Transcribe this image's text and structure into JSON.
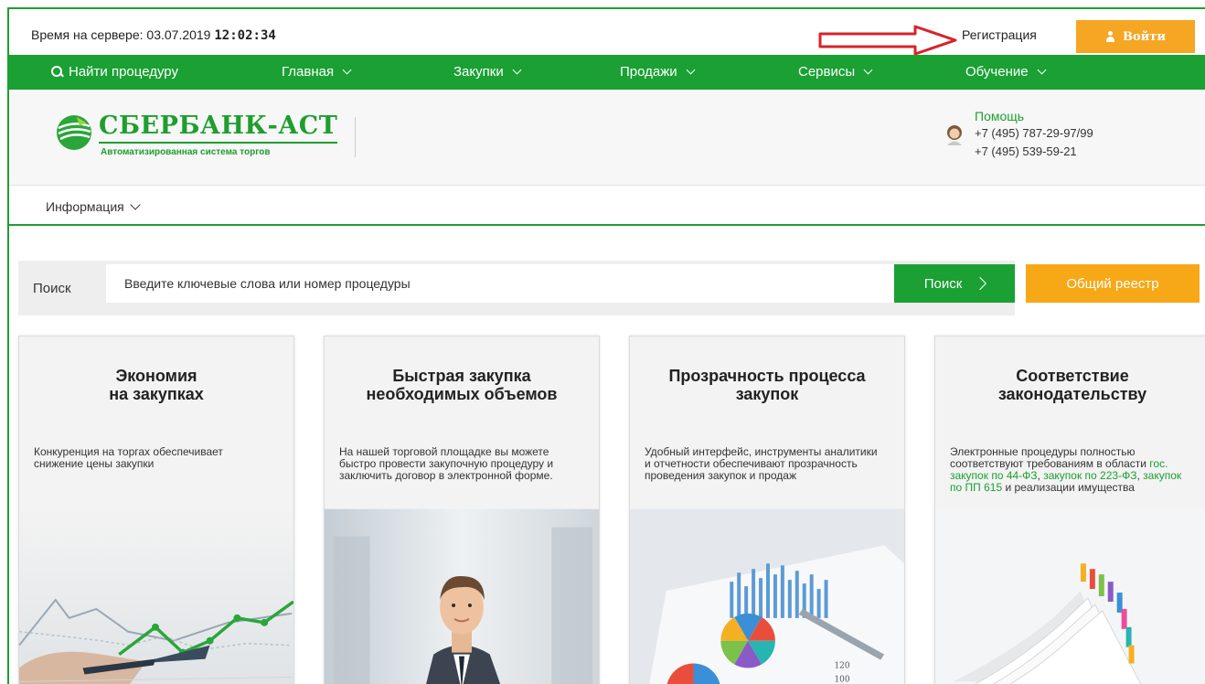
{
  "topbar": {
    "server_time_label": "Время на сервере: 03.07.2019",
    "server_time_value": "12:02:34",
    "registration_label": "Регистрация",
    "login_label": "Войти"
  },
  "nav": {
    "search_label": "Найти процедуру",
    "items": [
      "Главная",
      "Закупки",
      "Продажи",
      "Сервисы",
      "Обучение"
    ]
  },
  "logo": {
    "title": "СБЕРБАНК-АСТ",
    "subtitle": "Автоматизированная система торгов"
  },
  "help": {
    "title": "Помощь",
    "phone1": "+7 (495) 787-29-97/99",
    "phone2": "+7 (495) 539-59-21"
  },
  "info": {
    "label": "Информация"
  },
  "search": {
    "label": "Поиск",
    "placeholder": "Введите ключевые слова или номер процедуры",
    "button_label": "Поиск",
    "registry_label": "Общий реестр"
  },
  "cards": [
    {
      "title": "Экономия\nна закупках",
      "text": "Конкуренция на торгах обеспечивает снижение цены закупки"
    },
    {
      "title": "Быстрая закупка\nнеобходимых объемов",
      "text": "На нашей торговой площадке вы можете быстро провести закупочную процедуру и заключить договор в электронной форме."
    },
    {
      "title": "Прозрачность процесса\nзакупок",
      "text": "Удобный интерфейс, инструменты аналитики и отчетности обеспечивают прозрачность проведения закупок и продаж"
    },
    {
      "title": "Соответствие\nзаконодательству",
      "text_prefix": "Электронные процедуры полностью соответствуют требованиям в области",
      "link1": "гос. закупок по 44-ФЗ",
      "sep1": ",",
      "link2": "закупок по 223-ФЗ",
      "sep2": ",",
      "link3": "закупок по ПП 615",
      "text_suffix": "и реализации имущества"
    }
  ],
  "colors": {
    "green": "#1aa033",
    "orange": "#f5a623",
    "arrow_red": "#d8232a"
  }
}
